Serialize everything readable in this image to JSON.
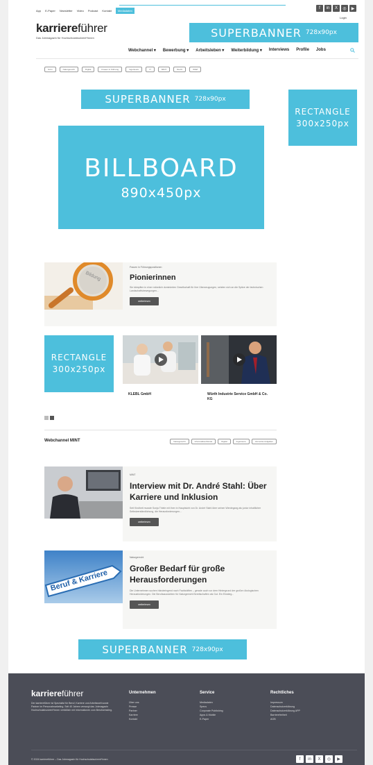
{
  "colors": {
    "accent": "#4dbfdc",
    "footer_bg": "#4b4d57",
    "button": "#555555"
  },
  "top_nav": {
    "items": [
      "App",
      "E-Paper",
      "Newsletter",
      "Video",
      "Podcast",
      "Kontakt"
    ],
    "highlight": "Mediadaten",
    "login": "Login"
  },
  "social_icons": [
    "facebook-icon",
    "linkedin-icon",
    "x-icon",
    "instagram-icon",
    "youtube-icon"
  ],
  "logo": {
    "bold": "karriere",
    "light": "führer",
    "tagline": "Das Jobmagazin für Hochschulabsolvent*innen"
  },
  "ads": {
    "superbanner": "SUPERBANNER",
    "superbanner_size": "728x90px",
    "rectangle": "RECTANGLE",
    "rectangle_size": "300x250px",
    "billboard": "BILLBOARD",
    "billboard_size": "890x450px"
  },
  "main_nav": {
    "items": [
      "Webchannel ▾",
      "Bewerbung ▾",
      "Arbeitsleben ▾",
      "Weiterbildung ▾",
      "Interviews",
      "Profile",
      "Jobs"
    ],
    "search_icon": "search-icon"
  },
  "chips": [
    "Grün",
    "Naturgerecht",
    "Digital",
    "Frauen in Führung",
    "Ingenieure",
    "IT",
    "MINT",
    "Recht",
    "WiWi"
  ],
  "feature": {
    "category": "Frauen in Führungspositionen",
    "title": "Pionierinnen",
    "teaser": "Sie kämpften in einer männlich dominierten Gesellschaft für ihre Überzeugungen, setzten sich an die Spitze der technischen Landschaftsbewegungen...",
    "button": "weiterlesen"
  },
  "videos": [
    {
      "company": "KLEBL GmbH"
    },
    {
      "company": "Würth Industrie Service GmbH & Co. KG"
    }
  ],
  "webchannel": {
    "title": "Webchannel MINT",
    "chips": [
      "Naturgerecht",
      "Informatikverbünde",
      "Digital",
      "Ingenieure",
      "Vernetzte Aufgaben"
    ]
  },
  "articles": [
    {
      "category": "MINT",
      "title": "Interview mit Dr. André Stahl: Über Karriere und Inklusion",
      "teaser": "Seit Kindheit musste Sonja Thiele mit ihrer in Hauptsicht von Dr. André Stahl über seinen Werdegang als junior inhaltlicher Selbstverständlichung, die Herausforderungen...",
      "button": "weiterlesen"
    },
    {
      "category": "Naturgerecht",
      "title": "Großer Bedarf für große Herausforderungen",
      "teaser": "Die Unternehmen suchen händeringend nach Fachkräften – gerade auch vor dem Hintergrund der großen ökologischen Herausforderungen. Die Berufsaussichten für Naturgerecht Bereitschaften als Gut. Ein Einstieg...",
      "button": "weiterlesen",
      "image_sign": "Beruf & Karriere"
    }
  ],
  "footer": {
    "logo_bold": "karriere",
    "logo_light": "führer",
    "description": "Der karriereführer ist Spezialist für Beruf, Karriere und Arbeitswelt sowie Partner im Personalmarketing. Seit 40 Jahren versorgt das Jobmagazin Hochschulabsolvent*innen verläßlich mit Informationen zum Berufseinstieg.",
    "columns": [
      {
        "title": "Unternehmen",
        "links": [
          "Über uns",
          "Presse",
          "Partner",
          "Karriere",
          "Kontakt"
        ]
      },
      {
        "title": "Service",
        "links": [
          "Mediadaten",
          "Specs",
          "Corporate Publishing",
          "Apps & Mobile",
          "E-Paper"
        ]
      },
      {
        "title": "Rechtliches",
        "links": [
          "Impressum",
          "Datenschutzerklärung",
          "Datenschutzerklärung APP",
          "Barrierefreiheit",
          "AGB"
        ]
      }
    ],
    "copyright": "© 2024 karriereführer – Das Jobmagazin für Hochschulabsolvent*innen"
  }
}
